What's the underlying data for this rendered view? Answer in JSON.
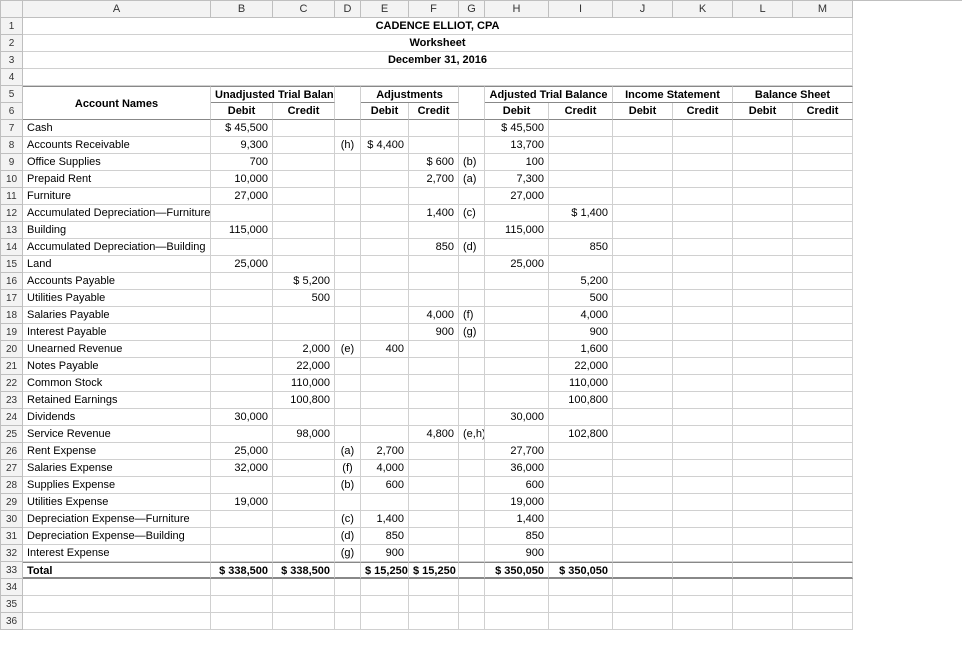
{
  "columns": [
    "A",
    "B",
    "C",
    "D",
    "E",
    "F",
    "G",
    "H",
    "I",
    "J",
    "K",
    "L",
    "M"
  ],
  "title1": "CADENCE ELLIOT, CPA",
  "title2": "Worksheet",
  "title3": "December 31, 2016",
  "headers": {
    "account": "Account Names",
    "groups": [
      "Unadjusted Trial Balance",
      "Adjustments",
      "Adjusted Trial Balance",
      "Income Statement",
      "Balance Sheet"
    ],
    "sub": [
      "Debit",
      "Credit"
    ]
  },
  "rows": [
    {
      "n": 7,
      "a": "Cash",
      "b": "$ 45,500",
      "h": "$ 45,500"
    },
    {
      "n": 8,
      "a": "Accounts Receivable",
      "b": "9,300",
      "d": "(h)",
      "e": "$ 4,400",
      "h": "13,700"
    },
    {
      "n": 9,
      "a": "Office Supplies",
      "b": "700",
      "f": "$    600",
      "g": "(b)",
      "h": "100"
    },
    {
      "n": 10,
      "a": "Prepaid Rent",
      "b": "10,000",
      "f": "2,700",
      "g": "(a)",
      "h": "7,300"
    },
    {
      "n": 11,
      "a": "Furniture",
      "b": "27,000",
      "h": "27,000"
    },
    {
      "n": 12,
      "a": "Accumulated Depreciation—Furniture",
      "f": "1,400",
      "g": "(c)",
      "i": "$   1,400"
    },
    {
      "n": 13,
      "a": "Building",
      "b": "115,000",
      "h": "115,000"
    },
    {
      "n": 14,
      "a": "Accumulated Depreciation—Building",
      "f": "850",
      "g": "(d)",
      "i": "850"
    },
    {
      "n": 15,
      "a": "Land",
      "b": "25,000",
      "h": "25,000"
    },
    {
      "n": 16,
      "a": "Accounts Payable",
      "c": "$   5,200",
      "i": "5,200"
    },
    {
      "n": 17,
      "a": "Utilities Payable",
      "c": "500",
      "i": "500"
    },
    {
      "n": 18,
      "a": "Salaries Payable",
      "f": "4,000",
      "g": "(f)",
      "i": "4,000"
    },
    {
      "n": 19,
      "a": "Interest Payable",
      "f": "900",
      "g": "(g)",
      "i": "900"
    },
    {
      "n": 20,
      "a": "Unearned Revenue",
      "c": "2,000",
      "d": "(e)",
      "e": "400",
      "i": "1,600"
    },
    {
      "n": 21,
      "a": "Notes Payable",
      "c": "22,000",
      "i": "22,000"
    },
    {
      "n": 22,
      "a": "Common Stock",
      "c": "110,000",
      "i": "110,000"
    },
    {
      "n": 23,
      "a": "Retained Earnings",
      "c": "100,800",
      "i": "100,800"
    },
    {
      "n": 24,
      "a": "Dividends",
      "b": "30,000",
      "h": "30,000"
    },
    {
      "n": 25,
      "a": "Service Revenue",
      "c": "98,000",
      "f": "4,800",
      "g": "(e,h)",
      "i": "102,800"
    },
    {
      "n": 26,
      "a": "Rent Expense",
      "b": "25,000",
      "d": "(a)",
      "e": "2,700",
      "h": "27,700"
    },
    {
      "n": 27,
      "a": "Salaries Expense",
      "b": "32,000",
      "d": "(f)",
      "e": "4,000",
      "h": "36,000"
    },
    {
      "n": 28,
      "a": "Supplies Expense",
      "d": "(b)",
      "e": "600",
      "h": "600"
    },
    {
      "n": 29,
      "a": "Utilities Expense",
      "b": "19,000",
      "h": "19,000"
    },
    {
      "n": 30,
      "a": "Depreciation Expense—Furniture",
      "d": "(c)",
      "e": "1,400",
      "h": "1,400"
    },
    {
      "n": 31,
      "a": "Depreciation Expense—Building",
      "d": "(d)",
      "e": "850",
      "h": "850"
    },
    {
      "n": 32,
      "a": "Interest Expense",
      "d": "(g)",
      "e": "900",
      "h": "900"
    }
  ],
  "total": {
    "n": 33,
    "label": "Total",
    "b": "$ 338,500",
    "c": "$ 338,500",
    "e": "$ 15,250",
    "f": "$ 15,250",
    "h": "$ 350,050",
    "i": "$ 350,050"
  },
  "blankRows": [
    34,
    35,
    36
  ]
}
